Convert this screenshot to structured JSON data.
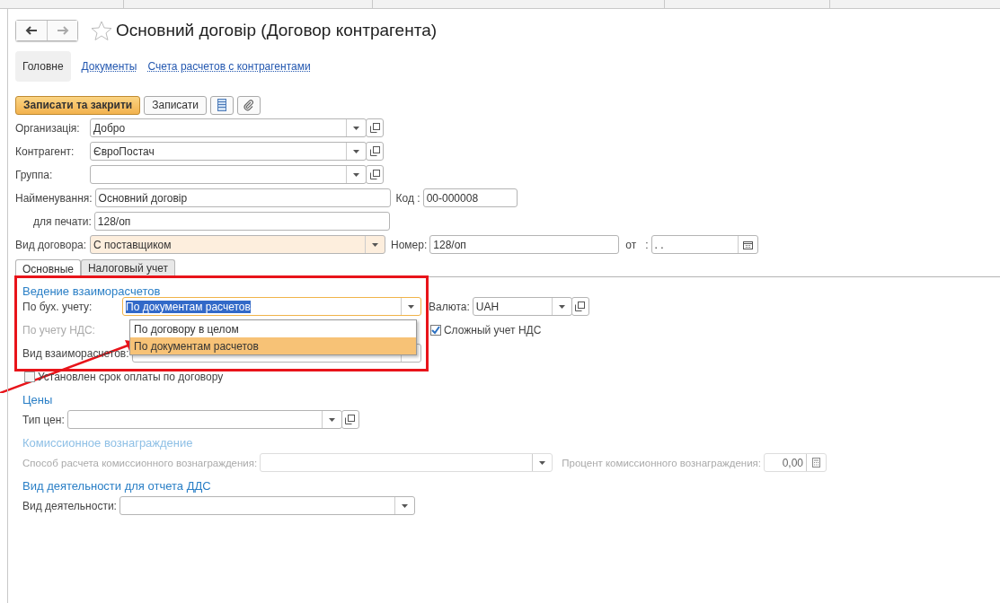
{
  "window": {
    "title": "Основний договір (Договор контрагента)"
  },
  "nav_buttons": [
    {
      "kind": "back",
      "disabled": false
    },
    {
      "kind": "forward",
      "disabled": true
    }
  ],
  "sections": [
    {
      "label": "Головне",
      "selected": true
    },
    {
      "label": "Документы",
      "selected": false
    },
    {
      "label": "Счета расчетов с контрагентами",
      "selected": false
    }
  ],
  "toolbar": [
    {
      "kind": "primary",
      "label": "Записати та закрити"
    },
    {
      "kind": "plain",
      "label": "Записати"
    },
    {
      "kind": "report"
    },
    {
      "kind": "attach"
    }
  ],
  "header_fields": [
    {
      "label": "Организація:",
      "value": "Добро",
      "kind": "choice",
      "sub": false,
      "highlighted": false
    },
    {
      "label": "Контрагент:",
      "value": "ЄвроПостач",
      "kind": "choice",
      "sub": false,
      "highlighted": false
    },
    {
      "label": "Группа:",
      "kind": "choice",
      "sub": false,
      "highlighted": false
    },
    {
      "label": "Найменування:",
      "value": "Основний договір",
      "kind": "text",
      "sub": false,
      "highlighted": false,
      "extras": [
        {
          "label": "Код :",
          "value": "00-000008",
          "kind": "code"
        }
      ]
    },
    {
      "label": "для печати:",
      "value": "128/оп",
      "kind": "text",
      "sub": true,
      "highlighted": false
    },
    {
      "label": "Вид договора:",
      "value": "С поставщиком",
      "kind": "select",
      "sub": false,
      "highlighted": true,
      "extras": [
        {
          "label": "Номер:",
          "value": "128/оп",
          "kind": "number"
        },
        {
          "label": "от",
          "colon": ":",
          "value": ". .",
          "kind": "date"
        }
      ]
    }
  ],
  "tabs": [
    {
      "label": "Основные",
      "selected": true
    },
    {
      "label": "Налоговый учет",
      "selected": false
    }
  ],
  "settlement": {
    "title": "Ведение взаиморасчетов",
    "accounting": {
      "label": "По бух. учету:",
      "value": "По документам расчетов",
      "focused": true
    },
    "currency": {
      "label": "Валюта:",
      "value": "UAH"
    },
    "vat": {
      "label": "По учету НДС:",
      "disabled": true
    },
    "complex_vat": {
      "label": "Сложный учет НДС",
      "checked": true
    },
    "settlement_kind": {
      "label": "Вид взаиморасчетов:"
    },
    "dropdown": [
      {
        "label": "По договору в целом",
        "selected": false
      },
      {
        "label": "По документам расчетов",
        "selected": true
      }
    ]
  },
  "payment_term": {
    "label": "Установлен срок оплаты по договору",
    "checked": false
  },
  "prices": {
    "title": "Цены",
    "price_type": {
      "label": "Тип цен:"
    }
  },
  "commission": {
    "title": "Комиссионное вознаграждение",
    "disabled": true,
    "method": {
      "label": "Способ расчета комиссионного вознаграждения:"
    },
    "percent": {
      "label": "Процент комиссионного вознаграждения:",
      "value": "0,00"
    }
  },
  "cash_flow": {
    "title": "Вид деятельности для отчета ДДС",
    "activity": {
      "label": "Вид деятельности:"
    }
  }
}
